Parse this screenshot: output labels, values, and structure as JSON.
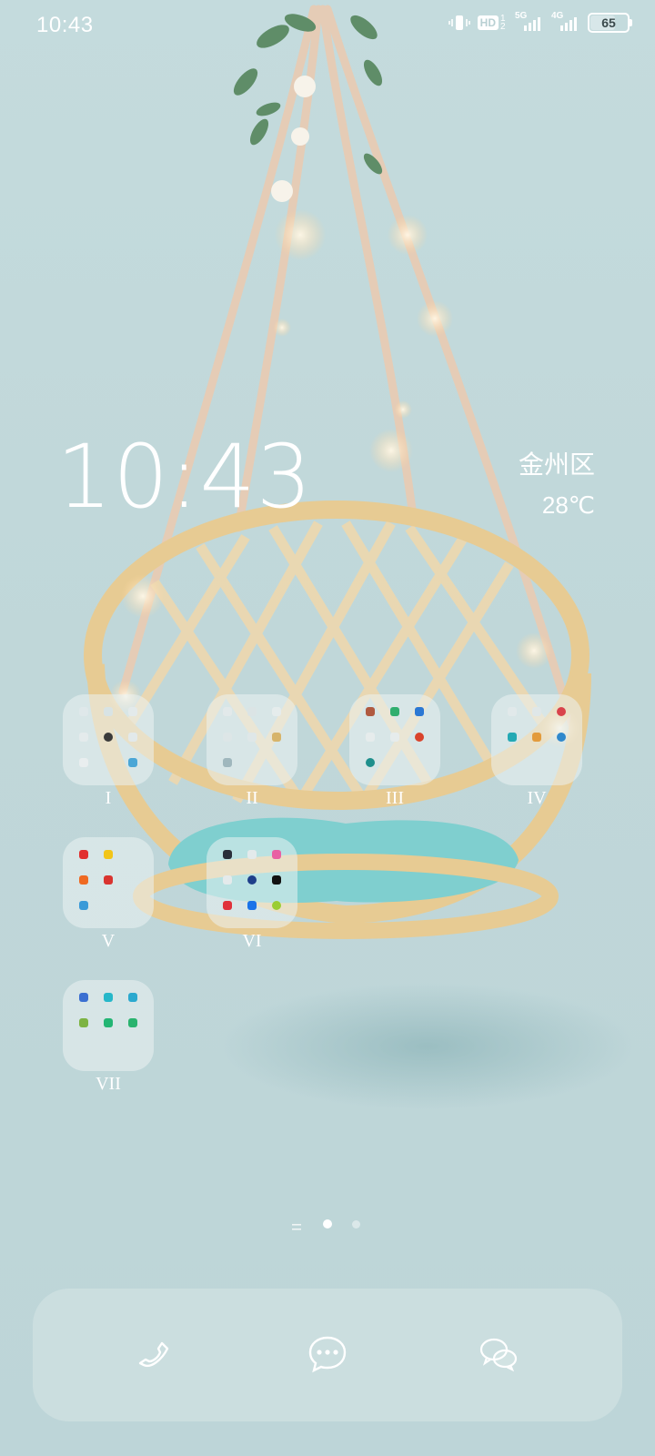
{
  "status_bar": {
    "time": "10:43",
    "network_1": "5G",
    "network_2": "4G",
    "hd_badge": "HD",
    "sim_numbers": "1 2",
    "battery_percent": "65",
    "battery_level": 0.65
  },
  "clock_widget": {
    "time": "10:43"
  },
  "weather_widget": {
    "location": "金州区",
    "temperature": "28℃"
  },
  "folders": [
    {
      "label": "I"
    },
    {
      "label": "II"
    },
    {
      "label": "III"
    },
    {
      "label": "IV"
    },
    {
      "label": "V"
    },
    {
      "label": "VI"
    },
    {
      "label": "VII"
    }
  ],
  "pager": {
    "pages": 2,
    "current": 1
  },
  "dock": {
    "phone_icon": "phone-icon",
    "messages_icon": "messages-icon",
    "wechat_icon": "wechat-icon"
  },
  "colors": {
    "background": "#c2d9db",
    "cushion": "#7fcfcf",
    "rattan": "#e9cf9b",
    "rope": "#e6cdb8"
  }
}
